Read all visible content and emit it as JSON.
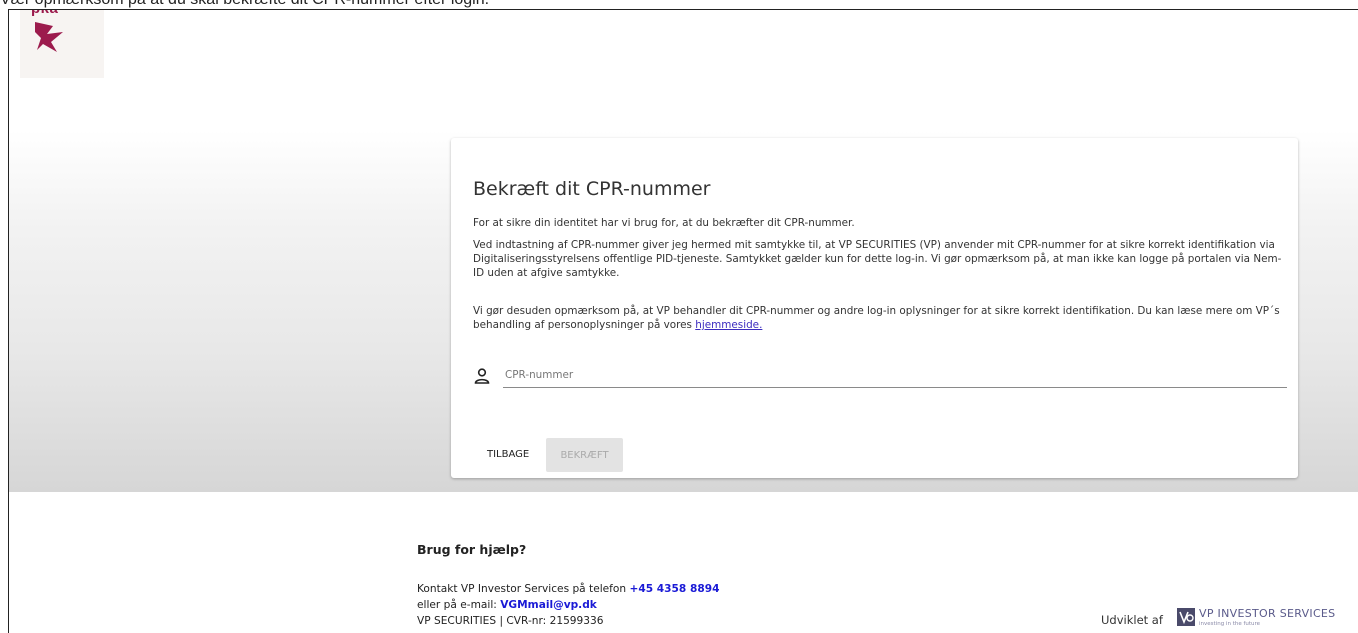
{
  "top_caption": "Vær opmærksom på at du skal bekræfte dit CPR-nummer efter login.",
  "logo": {
    "text": "pka",
    "color": "#9c1b4d"
  },
  "card": {
    "title": "Bekræft dit CPR-nummer",
    "p1": "For at sikre din identitet har vi brug for, at du bekræfter dit CPR-nummer.",
    "p2": "Ved indtastning af CPR-nummer giver jeg hermed mit samtykke til, at VP SECURITIES (VP) anvender mit CPR-nummer for at sikre korrekt identifikation via Digitaliseringsstyrelsens offentlige PID-tjeneste. Samtykket gælder kun for dette log-in. Vi gør opmærksom på, at man ikke kan logge på portalen via Nem-ID uden at afgive samtykke.",
    "p3_text": "Vi gør desuden opmærksom på, at VP behandler dit CPR-nummer og andre log-in oplysninger for at sikre korrekt identifikation. Du kan læse mere om VP´s behandling af personoplysninger på vores ",
    "p3_link": "hjemmeside.",
    "input": {
      "placeholder": "CPR-nummer",
      "value": "",
      "icon": "person-icon"
    },
    "buttons": {
      "back": "TILBAGE",
      "confirm": "BEKRÆFT"
    }
  },
  "help": {
    "title": "Brug for hjælp?",
    "phone_prefix": "Kontakt VP Investor Services på telefon ",
    "phone": "+45 4358 8894",
    "email_prefix": "eller på e-mail: ",
    "email": "VGMmail@vp.dk",
    "company": "VP SECURITIES | CVR-nr: 21599336"
  },
  "footer": {
    "developed_by": "Udviklet af",
    "vp_name": "VP INVESTOR SERVICES",
    "vp_tagline": "investing in the future"
  }
}
